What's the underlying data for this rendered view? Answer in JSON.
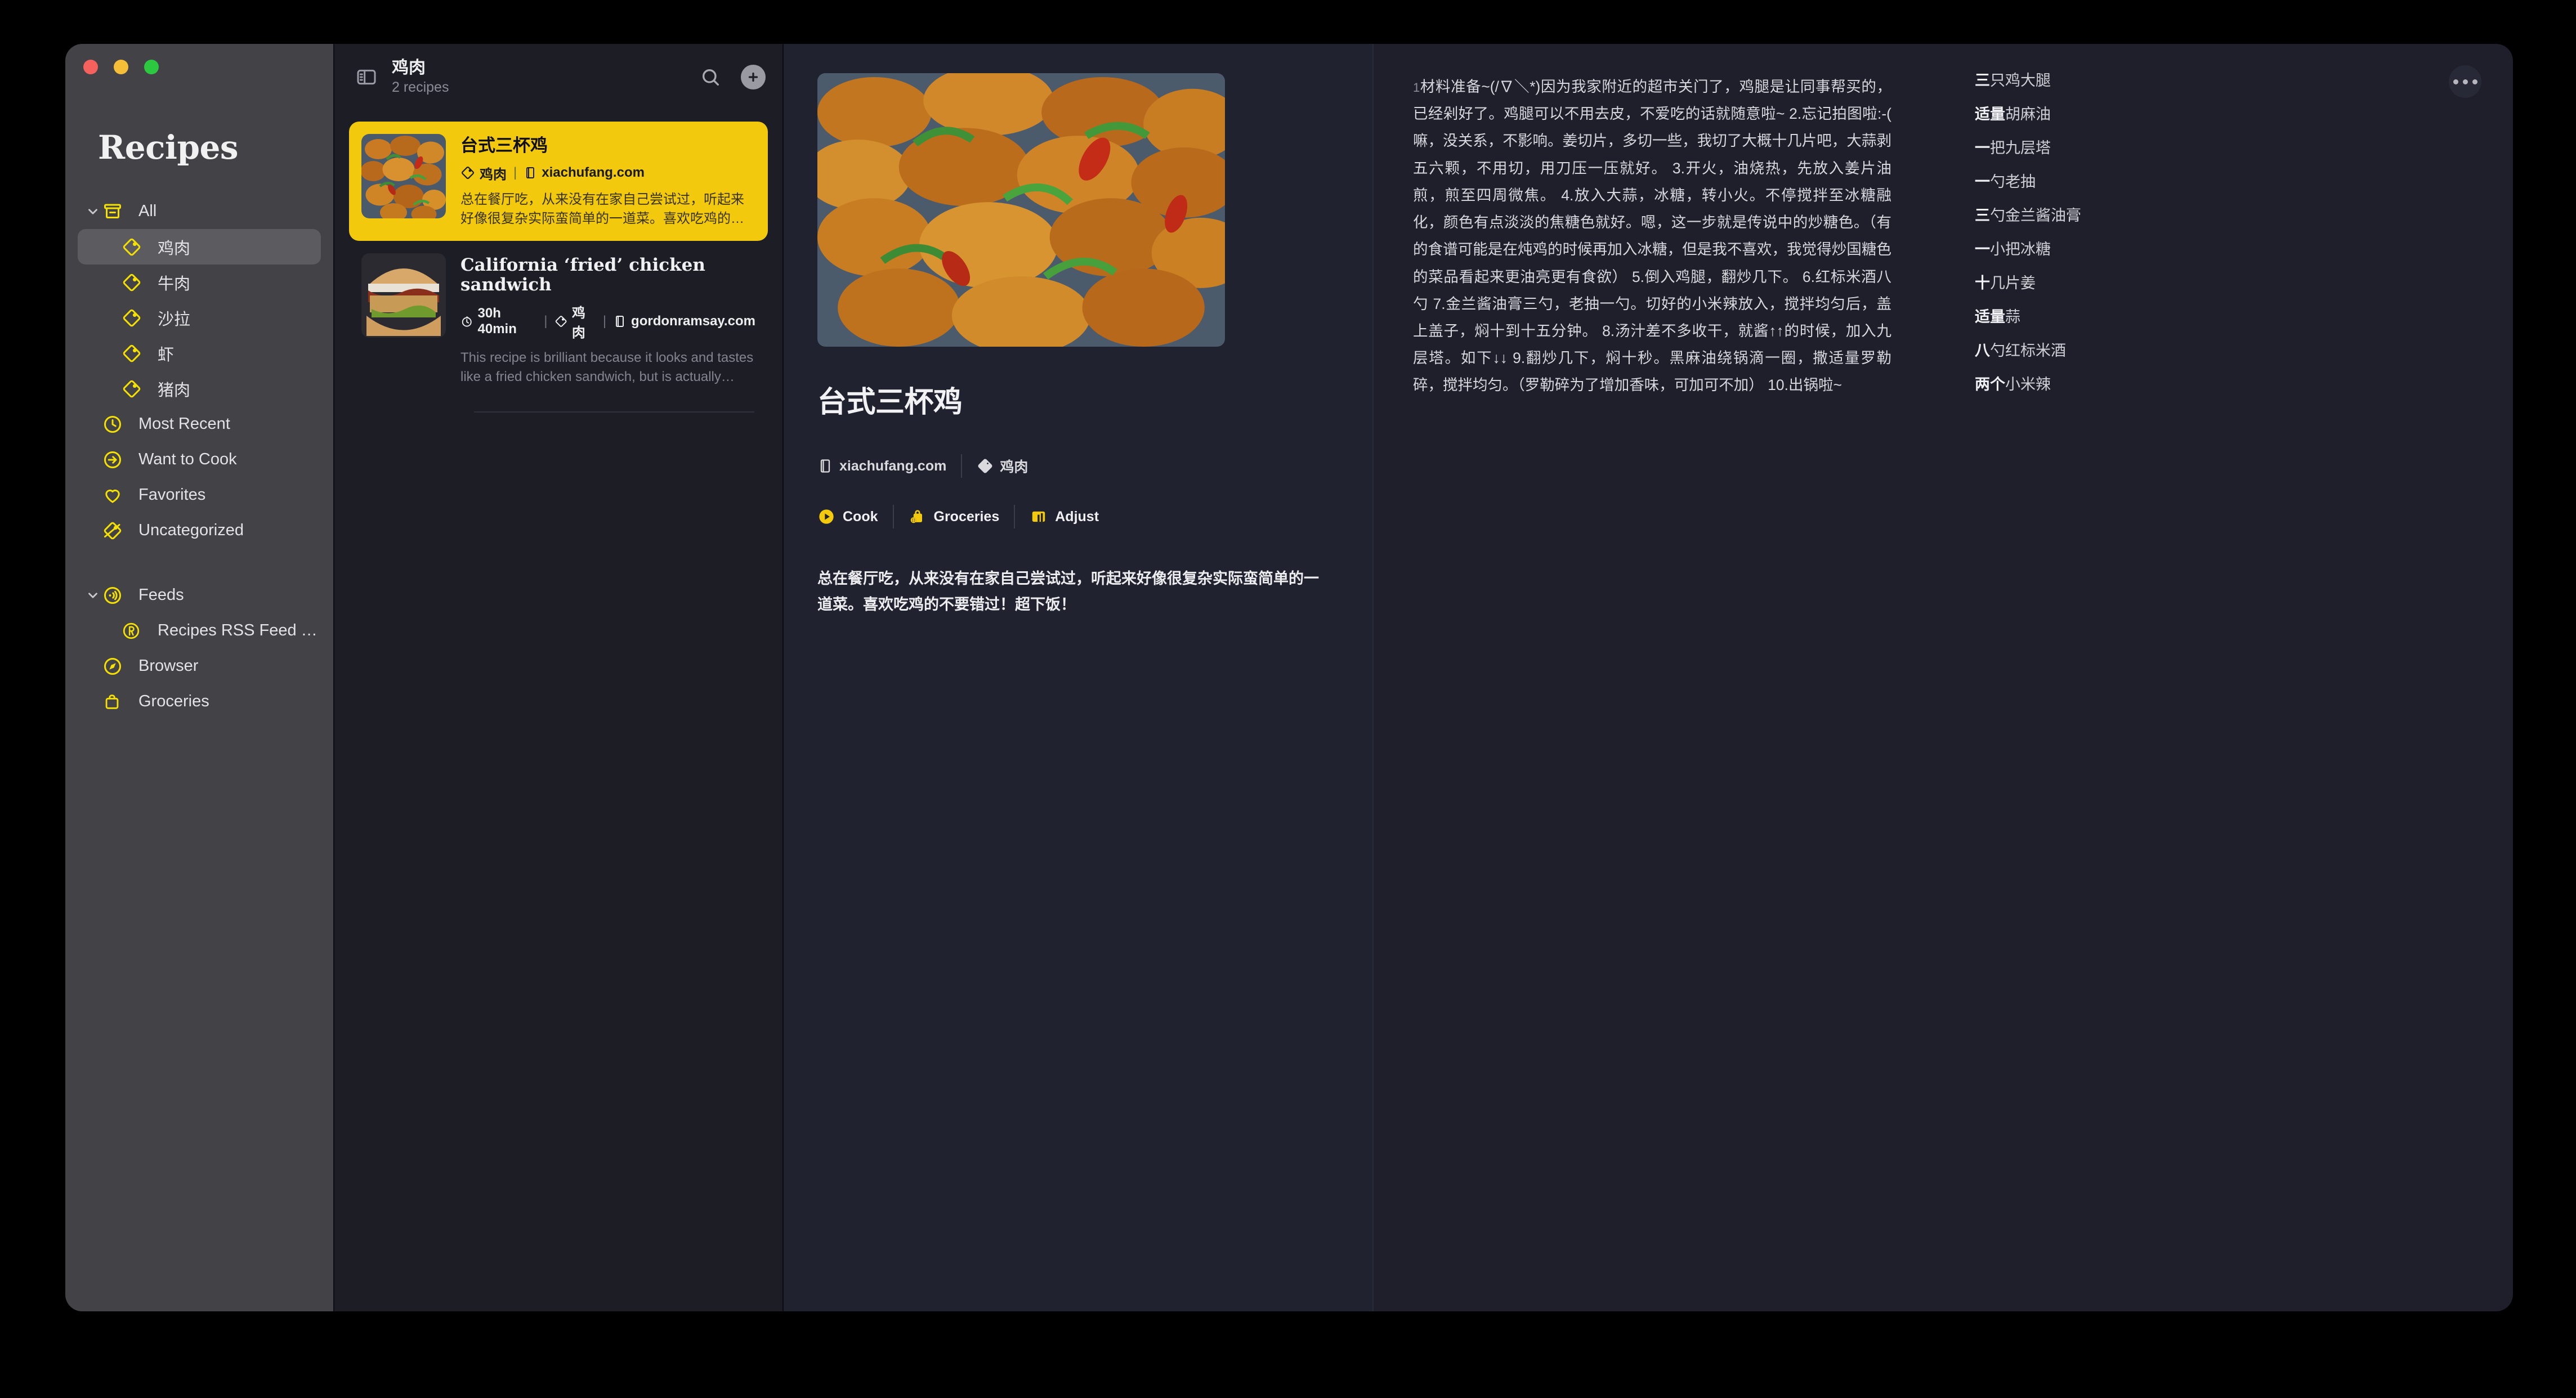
{
  "app": {
    "title": "Recipes",
    "window_controls": [
      "close",
      "minimize",
      "zoom"
    ]
  },
  "sidebar": {
    "items": [
      {
        "label": "All",
        "icon": "archive-box-icon",
        "indent": 0,
        "expandable": true,
        "expanded": true,
        "selected": false
      },
      {
        "label": "鸡肉",
        "icon": "tag-icon",
        "indent": 1,
        "expandable": false,
        "selected": true
      },
      {
        "label": "牛肉",
        "icon": "tag-icon",
        "indent": 1,
        "expandable": false,
        "selected": false
      },
      {
        "label": "沙拉",
        "icon": "tag-icon",
        "indent": 1,
        "expandable": false,
        "selected": false
      },
      {
        "label": "虾",
        "icon": "tag-icon",
        "indent": 1,
        "expandable": false,
        "selected": false
      },
      {
        "label": "猪肉",
        "icon": "tag-icon",
        "indent": 1,
        "expandable": false,
        "selected": false
      },
      {
        "label": "Most Recent",
        "icon": "clock-icon",
        "indent": 0,
        "expandable": false,
        "selected": false
      },
      {
        "label": "Want to Cook",
        "icon": "arrow-right-circle-icon",
        "indent": 0,
        "expandable": false,
        "selected": false
      },
      {
        "label": "Favorites",
        "icon": "heart-icon",
        "indent": 0,
        "expandable": false,
        "selected": false
      },
      {
        "label": "Uncategorized",
        "icon": "tag-slash-icon",
        "indent": 0,
        "expandable": false,
        "selected": false
      }
    ],
    "feeds_section": [
      {
        "label": "Feeds",
        "icon": "rss-wave-icon",
        "indent": 0,
        "expandable": true,
        "expanded": true,
        "selected": false
      },
      {
        "label": "Recipes RSS Feed Nov…",
        "icon": "registered-r-icon",
        "indent": 1,
        "expandable": false,
        "selected": false
      },
      {
        "label": "Browser",
        "icon": "compass-icon",
        "indent": 0,
        "expandable": false,
        "selected": false
      },
      {
        "label": "Groceries",
        "icon": "basket-icon",
        "indent": 0,
        "expandable": false,
        "selected": false
      }
    ]
  },
  "list_panel": {
    "title": "鸡肉",
    "subtitle": "2 recipes",
    "toggle_sidebar_icon": "sidebar-toggle-icon",
    "search_icon": "search-icon",
    "add_icon": "plus-icon",
    "recipes": [
      {
        "title": "台式三杯鸡",
        "selected": true,
        "time": "",
        "tag": "鸡肉",
        "source": "xiachufang.com",
        "description": "总在餐厅吃，从来没有在家自己尝试过，听起来好像很复杂实际蛮简单的一道菜。喜欢吃鸡的不要错…"
      },
      {
        "title": "California ‘fried’ chicken sandwich",
        "selected": false,
        "time": "30h 40min",
        "tag": "鸡肉",
        "source": "gordonramsay.com",
        "description": "This recipe is brilliant because it looks and tastes like a fried chicken sandwich, but is actually ma…"
      }
    ]
  },
  "detail": {
    "title": "台式三杯鸡",
    "hero_image": "three-cup-chicken-photo",
    "meta": {
      "source": "xiachufang.com",
      "source_icon": "book-icon",
      "tag": "鸡肉",
      "tag_icon": "tag-icon"
    },
    "actions": [
      {
        "label": "Cook",
        "icon": "play-circle-icon"
      },
      {
        "label": "Groceries",
        "icon": "grocery-bag-plus-icon"
      },
      {
        "label": "Adjust",
        "icon": "adjust-columns-icon"
      }
    ],
    "description": "总在餐厅吃，从来没有在家自己尝试过，听起来好像很复杂实际蛮简单的一道菜。喜欢吃鸡的不要错过！超下饭！"
  },
  "notes": {
    "more_icon": "ellipsis-icon",
    "directions_number": "1",
    "directions": "材料准备~(/∇＼*)因为我家附近的超市关门了，鸡腿是让同事帮买的，已经剁好了。鸡腿可以不用去皮，不爱吃的话就随意啦~ 2.忘记拍图啦:-( 嘛，没关系，不影响。姜切片，多切一些，我切了大概十几片吧，大蒜剥五六颗，不用切，用刀压一压就好。 3.开火，油烧热，先放入姜片油煎，煎至四周微焦。 4.放入大蒜，冰糖，转小火。不停搅拌至冰糖融化，颜色有点淡淡的焦糖色就好。嗯，这一步就是传说中的炒糖色。（有的食谱可能是在炖鸡的时候再加入冰糖，但是我不喜欢，我觉得炒国糖色的菜品看起来更油亮更有食欲） 5.倒入鸡腿，翻炒几下。 6.红标米酒八勺 7.金兰酱油膏三勺，老抽一勺。切好的小米辣放入，搅拌均匀后，盖上盖子，焖十到十五分钟。 8.汤汁差不多收干，就酱↑↑的时候，加入九层塔。如下↓↓ 9.翻炒几下，焖十秒。黑麻油绕锅滴一圈，撒适量罗勒碎，搅拌均匀。（罗勒碎为了增加香味，可加可不加） 10.出锅啦~",
    "ingredients": [
      {
        "qty": "三",
        "text": "只鸡大腿"
      },
      {
        "qty": "适量",
        "text": "胡麻油"
      },
      {
        "qty": "一",
        "text": "把九层塔"
      },
      {
        "qty": "一",
        "text": "勺老抽"
      },
      {
        "qty": "三",
        "text": "勺金兰酱油膏"
      },
      {
        "qty": "一",
        "text": "小把冰糖"
      },
      {
        "qty": "十",
        "text": "几片姜"
      },
      {
        "qty": "适量",
        "text": "蒜"
      },
      {
        "qty": "八",
        "text": "勺红标米酒"
      },
      {
        "qty": "两个",
        "text": "小米辣"
      }
    ]
  },
  "colors": {
    "accent_yellow": "#F2C90C",
    "sidebar_bg": "#434347",
    "list_bg": "#1D1D26",
    "detail_bg": "#212230",
    "notes_bg": "#1E1F2B",
    "selected_row": "#5C5C60"
  }
}
